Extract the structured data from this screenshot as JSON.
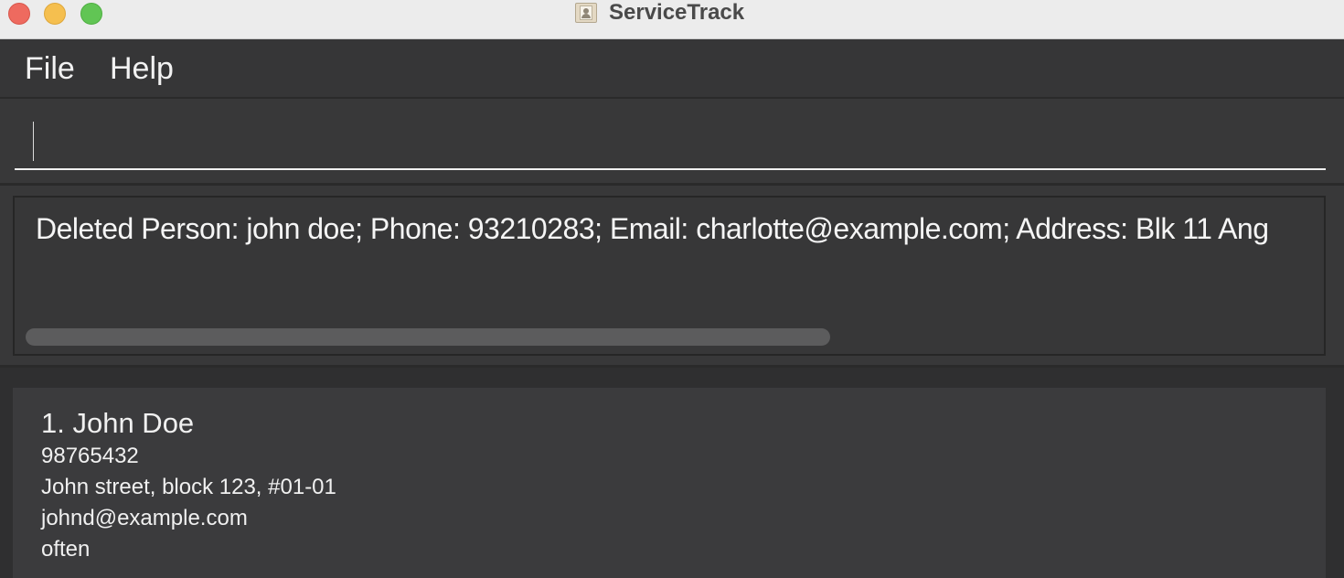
{
  "window": {
    "title": "ServiceTrack",
    "app_icon": "address-book-icon"
  },
  "menu": {
    "items": [
      "File",
      "Help"
    ]
  },
  "command": {
    "value": "",
    "placeholder": ""
  },
  "result": {
    "message": "Deleted Person: john doe; Phone: 93210283; Email: charlotte@example.com; Address: Blk 11 Ang"
  },
  "persons": [
    {
      "index_name": "1. John Doe",
      "phone": "98765432",
      "address": "John street, block 123, #01-01",
      "email": "johnd@example.com",
      "tag": "often"
    }
  ],
  "colors": {
    "background": "#2f2f30",
    "panel": "#383839",
    "card": "#3b3b3d",
    "text": "#f0f0f0",
    "close": "#ee6a5f",
    "minimize": "#f5bf4f",
    "maximize": "#61c554"
  }
}
